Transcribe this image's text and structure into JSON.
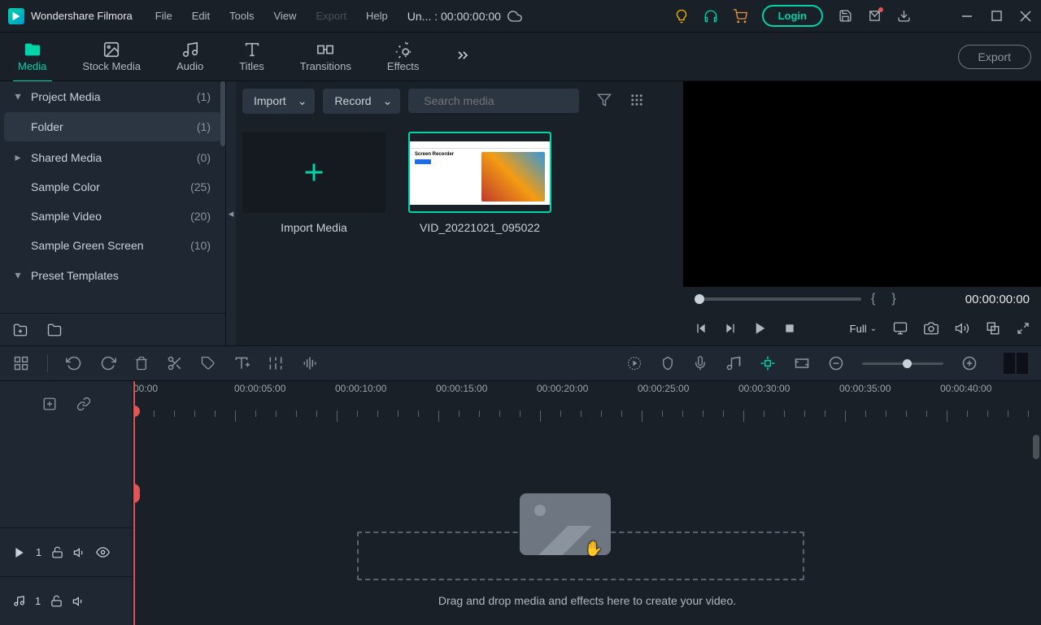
{
  "app_name": "Wondershare Filmora",
  "menu": [
    "File",
    "Edit",
    "Tools",
    "View",
    "Export",
    "Help"
  ],
  "menu_disabled_index": 4,
  "project_label": "Un... : 00:00:00:00",
  "login_label": "Login",
  "mode_tabs": [
    {
      "label": "Media",
      "active": true
    },
    {
      "label": "Stock Media"
    },
    {
      "label": "Audio"
    },
    {
      "label": "Titles"
    },
    {
      "label": "Transitions"
    },
    {
      "label": "Effects"
    }
  ],
  "export_label": "Export",
  "sidebar": [
    {
      "label": "Project Media",
      "count": "(1)",
      "expanded": true,
      "indent": 0,
      "arrow": "down"
    },
    {
      "label": "Folder",
      "count": "(1)",
      "indent": 1,
      "selected": true
    },
    {
      "label": "Shared Media",
      "count": "(0)",
      "indent": 0,
      "arrow": "right"
    },
    {
      "label": "Sample Color",
      "count": "(25)",
      "indent": 1
    },
    {
      "label": "Sample Video",
      "count": "(20)",
      "indent": 1
    },
    {
      "label": "Sample Green Screen",
      "count": "(10)",
      "indent": 1
    },
    {
      "label": "Preset Templates",
      "count": "",
      "indent": 0,
      "arrow": "down"
    }
  ],
  "browser": {
    "import_label": "Import",
    "record_label": "Record",
    "search_placeholder": "Search media",
    "import_tile_label": "Import Media",
    "clip_label": "VID_20221021_095022",
    "clip_thumb_heading": "Screen Recorder"
  },
  "preview": {
    "brackets": "{}",
    "timecode": "00:00:00:00",
    "quality": "Full"
  },
  "timeline": {
    "marks": [
      "00:00",
      "00:00:05:00",
      "00:00:10:00",
      "00:00:15:00",
      "00:00:20:00",
      "00:00:25:00",
      "00:00:30:00",
      "00:00:35:00",
      "00:00:40:00"
    ],
    "drop_text": "Drag and drop media and effects here to create your video.",
    "video_track_n": "1",
    "audio_track_n": "1"
  }
}
